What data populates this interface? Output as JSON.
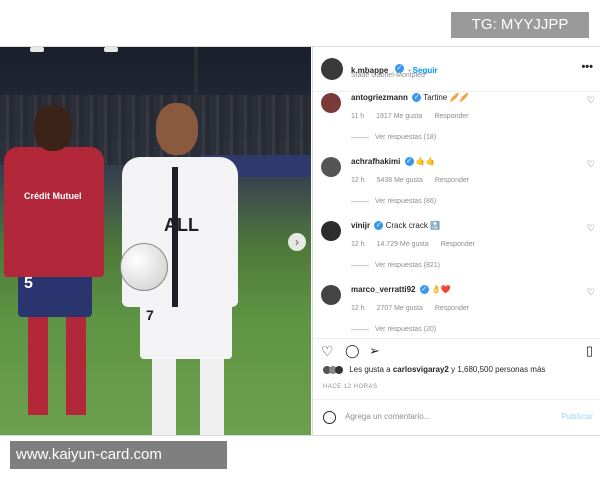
{
  "watermarks": {
    "top": "TG: MYYJJPP",
    "bottom": "www.kaiyun-card.com"
  },
  "post": {
    "username": "k.mbappe",
    "follow_label": "Seguir",
    "location": "Stade Gabriel-Montpied",
    "more_icon": "more-dots-icon",
    "verified_color": "#3897f0"
  },
  "comments": [
    {
      "user": "antogriezmann",
      "text": "Tartine 🥖🥖",
      "time": "11 h",
      "likes": "1917 Me gusta",
      "reply": "Responder",
      "replies": "Ver respuestas (18)"
    },
    {
      "user": "achrafhakimi",
      "text": "🤙🤙",
      "time": "12 h",
      "likes": "5438 Me gusta",
      "reply": "Responder",
      "replies": "Ver respuestas (86)"
    },
    {
      "user": "vinijr",
      "text": "Crack crack 🔝",
      "time": "12 h",
      "likes": "14.729 Me gusta",
      "reply": "Responder",
      "replies": "Ver respuestas (821)"
    },
    {
      "user": "marco_verratti92",
      "text": "👌❤️",
      "time": "12 h",
      "likes": "2707 Me gusta",
      "reply": "Responder",
      "replies": "Ver respuestas (20)"
    }
  ],
  "likes": {
    "prefix": "Les gusta a",
    "user": "carlosvigaray2",
    "suffix": "y 1,680,500 personas más"
  },
  "timestamp": "HACE 12 HORAS",
  "comment_input": {
    "placeholder": "Agrega un comentario...",
    "publish_label": "Publicar"
  },
  "photo": {
    "jersey_left_text": "Crédit Mutuel",
    "jersey_right_text": "ALL",
    "number_left": "5",
    "number_right": "7"
  }
}
